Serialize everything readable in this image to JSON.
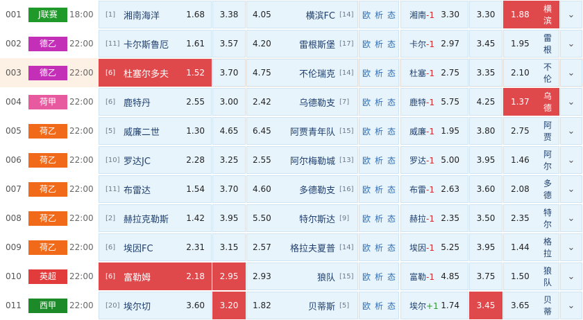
{
  "matches": [
    {
      "num": "001",
      "league": "J联赛",
      "league_color": "#1f9a2a",
      "time": "18:00",
      "home_rank": "[1]",
      "home": "湘南海洋",
      "home_odd": "1.68",
      "draw_odd": "3.38",
      "away_odd": "4.05",
      "away": "横滨FC",
      "away_rank": "[14]",
      "links": [
        "欧",
        "析",
        "态"
      ],
      "hc_team": "湘南",
      "hc_value": "-1",
      "hc_home_odd": "3.30",
      "hc_draw_odd": "3.30",
      "hc_away_odd": "1.88",
      "hc_away_team": "横滨",
      "highlight": [
        "hc_away"
      ],
      "alt": false
    },
    {
      "num": "002",
      "league": "德乙",
      "league_color": "#c42fb8",
      "time": "22:00",
      "home_rank": "[11]",
      "home": "卡尔斯鲁厄",
      "home_odd": "1.61",
      "draw_odd": "3.57",
      "away_odd": "4.20",
      "away": "雷根斯堡",
      "away_rank": "[17]",
      "links": [
        "欧",
        "析",
        "态"
      ],
      "hc_team": "卡尔",
      "hc_value": "-1",
      "hc_home_odd": "2.97",
      "hc_draw_odd": "3.45",
      "hc_away_odd": "1.95",
      "hc_away_team": "雷根",
      "highlight": [],
      "alt": false
    },
    {
      "num": "003",
      "league": "德乙",
      "league_color": "#c42fb8",
      "time": "22:00",
      "home_rank": "[6]",
      "home": "杜塞尔多夫",
      "home_odd": "1.52",
      "draw_odd": "3.70",
      "away_odd": "4.75",
      "away": "不伦瑞克",
      "away_rank": "[14]",
      "links": [
        "欧",
        "析",
        "态"
      ],
      "hc_team": "杜塞",
      "hc_value": "-1",
      "hc_home_odd": "2.75",
      "hc_draw_odd": "3.35",
      "hc_away_odd": "2.10",
      "hc_away_team": "不伦",
      "highlight": [
        "home"
      ],
      "alt": true
    },
    {
      "num": "004",
      "league": "荷甲",
      "league_color": "#e85aa0",
      "time": "22:00",
      "home_rank": "[6]",
      "home": "鹿特丹",
      "home_odd": "2.55",
      "draw_odd": "3.00",
      "away_odd": "2.42",
      "away": "乌德勒支",
      "away_rank": "[7]",
      "links": [
        "欧",
        "析",
        "态"
      ],
      "hc_team": "鹿特",
      "hc_value": "-1",
      "hc_home_odd": "5.75",
      "hc_draw_odd": "4.25",
      "hc_away_odd": "1.37",
      "hc_away_team": "乌德",
      "highlight": [
        "hc_away"
      ],
      "alt": false
    },
    {
      "num": "005",
      "league": "荷乙",
      "league_color": "#f06a1a",
      "time": "22:00",
      "home_rank": "[5]",
      "home": "威廉二世",
      "home_odd": "1.30",
      "draw_odd": "4.65",
      "away_odd": "6.45",
      "away": "阿贾青年队",
      "away_rank": "[15]",
      "links": [
        "欧",
        "析",
        "态"
      ],
      "hc_team": "威廉",
      "hc_value": "-1",
      "hc_home_odd": "1.95",
      "hc_draw_odd": "3.80",
      "hc_away_odd": "2.75",
      "hc_away_team": "阿贾",
      "highlight": [],
      "alt": false
    },
    {
      "num": "006",
      "league": "荷乙",
      "league_color": "#f06a1a",
      "time": "22:00",
      "home_rank": "[10]",
      "home": "罗达JC",
      "home_odd": "2.28",
      "draw_odd": "3.25",
      "away_odd": "2.55",
      "away": "阿尔梅勒城",
      "away_rank": "[13]",
      "links": [
        "欧",
        "析",
        "态"
      ],
      "hc_team": "罗达",
      "hc_value": "-1",
      "hc_home_odd": "5.00",
      "hc_draw_odd": "3.95",
      "hc_away_odd": "1.46",
      "hc_away_team": "阿尔",
      "highlight": [],
      "alt": false
    },
    {
      "num": "007",
      "league": "荷乙",
      "league_color": "#f06a1a",
      "time": "22:00",
      "home_rank": "[11]",
      "home": "布雷达",
      "home_odd": "1.54",
      "draw_odd": "3.70",
      "away_odd": "4.60",
      "away": "多德勒支",
      "away_rank": "[16]",
      "links": [
        "欧",
        "析",
        "态"
      ],
      "hc_team": "布雷",
      "hc_value": "-1",
      "hc_home_odd": "2.63",
      "hc_draw_odd": "3.60",
      "hc_away_odd": "2.08",
      "hc_away_team": "多德",
      "highlight": [],
      "alt": false
    },
    {
      "num": "008",
      "league": "荷乙",
      "league_color": "#f06a1a",
      "time": "22:00",
      "home_rank": "[2]",
      "home": "赫拉克勒斯",
      "home_odd": "1.42",
      "draw_odd": "3.95",
      "away_odd": "5.50",
      "away": "特尔斯达",
      "away_rank": "[9]",
      "links": [
        "欧",
        "析",
        "态"
      ],
      "hc_team": "赫拉",
      "hc_value": "-1",
      "hc_home_odd": "2.35",
      "hc_draw_odd": "3.50",
      "hc_away_odd": "2.35",
      "hc_away_team": "特尔",
      "highlight": [],
      "alt": false
    },
    {
      "num": "009",
      "league": "荷乙",
      "league_color": "#f06a1a",
      "time": "22:00",
      "home_rank": "[6]",
      "home": "埃因FC",
      "home_odd": "2.31",
      "draw_odd": "3.15",
      "away_odd": "2.57",
      "away": "格拉夫夏普",
      "away_rank": "[14]",
      "links": [
        "欧",
        "析",
        "态"
      ],
      "hc_team": "埃因",
      "hc_value": "-1",
      "hc_home_odd": "5.25",
      "hc_draw_odd": "3.95",
      "hc_away_odd": "1.44",
      "hc_away_team": "格拉",
      "highlight": [],
      "alt": false
    },
    {
      "num": "010",
      "league": "英超",
      "league_color": "#e23b3b",
      "time": "22:00",
      "home_rank": "[6]",
      "home": "富勒姆",
      "home_odd": "2.18",
      "draw_odd": "2.95",
      "away_odd": "2.93",
      "away": "狼队",
      "away_rank": "[15]",
      "links": [
        "欧",
        "析",
        "态"
      ],
      "hc_team": "富勒",
      "hc_value": "-1",
      "hc_home_odd": "4.85",
      "hc_draw_odd": "3.75",
      "hc_away_odd": "1.50",
      "hc_away_team": "狼队",
      "highlight": [
        "home",
        "draw"
      ],
      "alt": false
    },
    {
      "num": "011",
      "league": "西甲",
      "league_color": "#1c8a28",
      "time": "22:00",
      "home_rank": "[20]",
      "home": "埃尔切",
      "home_odd": "3.60",
      "draw_odd": "3.20",
      "away_odd": "1.82",
      "away": "贝蒂斯",
      "away_rank": "[5]",
      "links": [
        "欧",
        "析",
        "态"
      ],
      "hc_team": "埃尔",
      "hc_value": "+1",
      "hc_home_odd": "1.74",
      "hc_draw_odd": "3.45",
      "hc_away_odd": "3.65",
      "hc_away_team": "贝蒂",
      "highlight": [
        "draw",
        "hc_draw"
      ],
      "alt": false
    }
  ],
  "more_icon": "chevron-down-icon",
  "more_glyph": "⌄"
}
